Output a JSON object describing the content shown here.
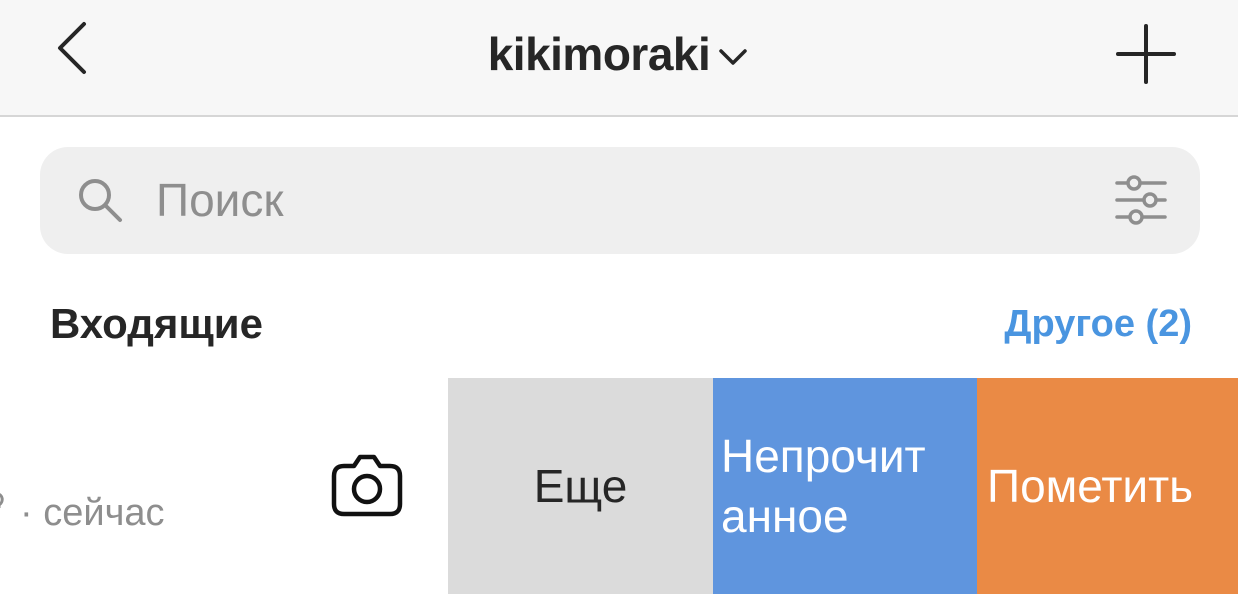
{
  "header": {
    "username": "kikimoraki"
  },
  "search": {
    "placeholder": "Поиск"
  },
  "inbox": {
    "title": "Входящие",
    "other_link": "Другое (2)"
  },
  "thread": {
    "time": "· сейчас"
  },
  "swipe_actions": {
    "more": "Еще",
    "unread_line1": "Непрочит",
    "unread_line2": "анное",
    "flag": "Пометить"
  },
  "colors": {
    "header_bg": "#f7f7f7",
    "search_bg": "#efefef",
    "link": "#4a95e0",
    "more_bg": "#dbdbdb",
    "unread_bg": "#5f95de",
    "flag_bg": "#ea8a45"
  },
  "icons": [
    "back-chevron-icon",
    "chevron-down-icon",
    "plus-icon",
    "search-icon",
    "filter-sliders-icon",
    "camera-icon"
  ]
}
